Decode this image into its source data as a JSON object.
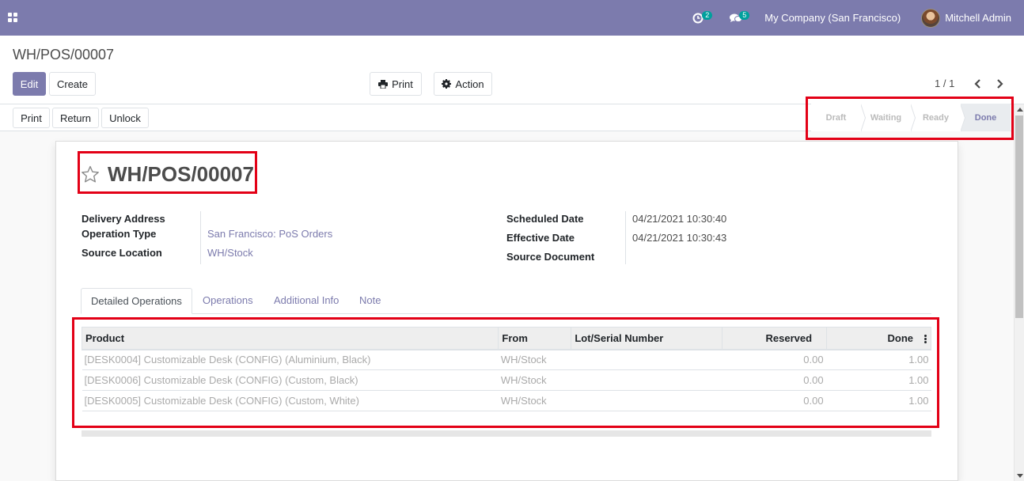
{
  "navbar": {
    "activity_count": "2",
    "message_count": "5",
    "company": "My Company (San Francisco)",
    "user": "Mitchell Admin"
  },
  "control_panel": {
    "breadcrumb": "WH/POS/00007",
    "edit_label": "Edit",
    "create_label": "Create",
    "print_label": "Print",
    "action_label": "Action",
    "pager": "1 / 1"
  },
  "statusbar": {
    "buttons": [
      "Print",
      "Return",
      "Unlock"
    ],
    "stages": [
      "Draft",
      "Waiting",
      "Ready",
      "Done"
    ],
    "current_stage": "Done"
  },
  "form": {
    "title": "WH/POS/00007",
    "left_fields": [
      {
        "label": "Delivery Address",
        "value": ""
      },
      {
        "label": "Operation Type",
        "value": "San Francisco: PoS Orders"
      },
      {
        "label": "Source Location",
        "value": "WH/Stock"
      }
    ],
    "right_fields": [
      {
        "label": "Scheduled Date",
        "value": "04/21/2021 10:30:40"
      },
      {
        "label": "Effective Date",
        "value": "04/21/2021 10:30:43"
      },
      {
        "label": "Source Document",
        "value": ""
      }
    ],
    "tabs": [
      "Detailed Operations",
      "Operations",
      "Additional Info",
      "Note"
    ],
    "active_tab": "Detailed Operations"
  },
  "operations_table": {
    "columns": [
      "Product",
      "From",
      "Lot/Serial Number",
      "Reserved",
      "Done"
    ],
    "rows": [
      {
        "product": "[DESK0004] Customizable Desk (CONFIG) (Aluminium, Black)",
        "from": "WH/Stock",
        "lot": "",
        "reserved": "0.00",
        "done": "1.00"
      },
      {
        "product": "[DESK0006] Customizable Desk (CONFIG) (Custom, Black)",
        "from": "WH/Stock",
        "lot": "",
        "reserved": "0.00",
        "done": "1.00"
      },
      {
        "product": "[DESK0005] Customizable Desk (CONFIG) (Custom, White)",
        "from": "WH/Stock",
        "lot": "",
        "reserved": "0.00",
        "done": "1.00"
      }
    ]
  },
  "colors": {
    "brand": "#7c7bad",
    "badge": "#00a09d",
    "highlight": "#e30016"
  }
}
